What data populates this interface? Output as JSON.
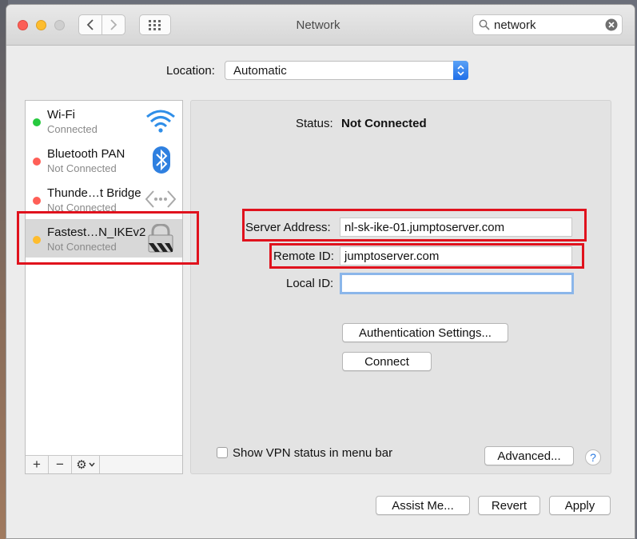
{
  "window": {
    "title": "Network",
    "search_value": "network"
  },
  "location": {
    "label": "Location:",
    "value": "Automatic"
  },
  "services": [
    {
      "name": "Wi-Fi",
      "status": "Connected",
      "dot_color": "#27c93f",
      "icon": "wifi-icon"
    },
    {
      "name": "Bluetooth PAN",
      "status": "Not Connected",
      "dot_color": "#ff5f57",
      "icon": "bluetooth-icon"
    },
    {
      "name": "Thunde…t Bridge",
      "status": "Not Connected",
      "dot_color": "#ff5f57",
      "icon": "thunderbolt-bridge-icon"
    },
    {
      "name": "Fastest…N_IKEv2",
      "status": "Not Connected",
      "dot_color": "#febc2e",
      "icon": "vpn-lock-icon",
      "selected": true
    }
  ],
  "sidebar_tools": {
    "add": "+",
    "remove": "−",
    "gear": "⚙"
  },
  "detail": {
    "status_label": "Status:",
    "status_value": "Not Connected",
    "server_address_label": "Server Address:",
    "server_address_value": "nl-sk-ike-01.jumptoserver.com",
    "remote_id_label": "Remote ID:",
    "remote_id_value": "jumptoserver.com",
    "local_id_label": "Local ID:",
    "local_id_value": "",
    "auth_button": "Authentication Settings...",
    "connect_button": "Connect",
    "show_vpn_status": "Show VPN status in menu bar",
    "show_vpn_checked": false,
    "advanced_button": "Advanced...",
    "help": "?"
  },
  "footer": {
    "assist": "Assist Me...",
    "revert": "Revert",
    "apply": "Apply"
  },
  "colors": {
    "highlight_box": "#e0121d",
    "focus_ring": "#8bb6ea"
  }
}
